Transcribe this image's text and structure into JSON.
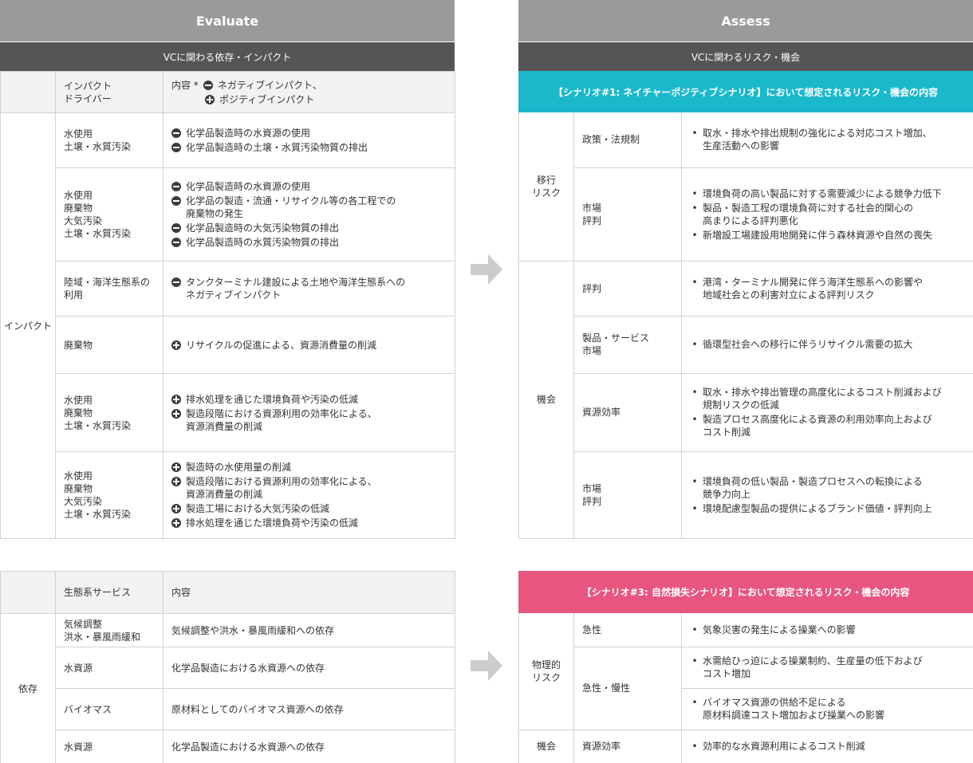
{
  "evaluate": {
    "title": "Evaluate",
    "subtitle": "VCに関わる依存・インパクト",
    "impact_table": {
      "header": {
        "driver": "インパクト\nドライバー",
        "content_label": "内容 *",
        "neg_label": "ネガティブインパクト、",
        "pos_label": "ポジティブインパクト"
      },
      "group_label": "インパクト",
      "rows": [
        {
          "driver": "水使用\n土壌・水質汚染",
          "items": [
            {
              "icon": "minus",
              "text": "化学品製造時の水資源の使用"
            },
            {
              "icon": "minus",
              "text": "化学品製造時の土壌・水質汚染物質の排出"
            }
          ]
        },
        {
          "driver": "水使用\n廃棄物\n大気汚染\n土壌・水質汚染",
          "items": [
            {
              "icon": "minus",
              "text": "化学品製造時の水資源の使用"
            },
            {
              "icon": "minus",
              "text": "化学品の製造・流通・リサイクル等の各工程での\n廃棄物の発生"
            },
            {
              "icon": "minus",
              "text": "化学品製造時の大気汚染物質の排出"
            },
            {
              "icon": "minus",
              "text": "化学品製造時の水質汚染物質の排出"
            }
          ]
        },
        {
          "driver": "陸域・海洋生態系の\n利用",
          "items": [
            {
              "icon": "minus",
              "text": "タンクターミナル建設による土地や海洋生態系への\nネガティブインパクト"
            }
          ]
        },
        {
          "driver": "廃棄物",
          "items": [
            {
              "icon": "plus",
              "text": "リサイクルの促進による、資源消費量の削減"
            }
          ]
        },
        {
          "driver": "水使用\n廃棄物\n土壌・水質汚染",
          "items": [
            {
              "icon": "plus",
              "text": "排水処理を通じた環境負荷や汚染の低減"
            },
            {
              "icon": "plus",
              "text": "製造段階における資源利用の効率化による、\n資源消費量の削減"
            }
          ]
        },
        {
          "driver": "水使用\n廃棄物\n大気汚染\n土壌・水質汚染",
          "items": [
            {
              "icon": "plus",
              "text": "製造時の水使用量の削減"
            },
            {
              "icon": "plus",
              "text": "製造段階における資源利用の効率化による、\n資源消費量の削減"
            },
            {
              "icon": "plus",
              "text": "製造工場における大気汚染の低減"
            },
            {
              "icon": "plus",
              "text": "排水処理を通じた環境負荷や汚染の低減"
            }
          ]
        }
      ]
    },
    "dependency_table": {
      "header": {
        "service": "生態系サービス",
        "content": "内容"
      },
      "group_label": "依存",
      "rows": [
        {
          "service": "気候調整\n洪水・暴風雨緩和",
          "content": "気候調整や洪水・暴風雨緩和への依存"
        },
        {
          "service": "水資源",
          "content": "化学品製造における水資源への依存"
        },
        {
          "service": "バイオマス",
          "content": "原材料としてのバイオマス資源への依存"
        },
        {
          "service": "水資源",
          "content": "化学品製造における水資源への依存"
        }
      ]
    }
  },
  "assess": {
    "title": "Assess",
    "subtitle": "VCに関わるリスク・機会",
    "scenario1": {
      "title": "【シナリオ#1: ネイチャーポジティブシナリオ】において想定されるリスク・機会の内容",
      "color": "#1bb8cc",
      "transition_label": "移行\nリスク",
      "opportunity_label": "機会",
      "rows": [
        {
          "category": "政策・法規制",
          "bullets": [
            "取水・排水や排出規制の強化による対応コスト増加、\n生産活動への影響"
          ]
        },
        {
          "category": "市場\n評判",
          "bullets": [
            "環境負荷の高い製品に対する需要減少による競争力低下",
            "製品・製造工程の環境負荷に対する社会的関心の\n高まりによる評判悪化",
            "新増設工場建設用地開発に伴う森林資源や自然の喪失"
          ]
        },
        {
          "category": "評判",
          "bullets": [
            "港湾・ターミナル開発に伴う海洋生態系への影響や\n地域社会との利害対立による評判リスク"
          ]
        },
        {
          "category": "製品・サービス\n市場",
          "bullets": [
            "循環型社会への移行に伴うリサイクル需要の拡大"
          ]
        },
        {
          "category": "資源効率",
          "bullets": [
            "取水・排水や排出管理の高度化によるコスト削減および\n規制リスクの低減",
            "製造プロセス高度化による資源の利用効率向上および\nコスト削減"
          ]
        },
        {
          "category": "市場\n評判",
          "bullets": [
            "環境負荷の低い製品・製造プロセスへの転換による\n競争力向上",
            "環境配慮型製品の提供によるブランド価値・評判向上"
          ]
        }
      ]
    },
    "scenario3": {
      "title": "【シナリオ#3: 自然損失シナリオ】において想定されるリスク・機会の内容",
      "color": "#e8557e",
      "physical_label": "物理的\nリスク",
      "opportunity_label": "機会",
      "rows": [
        {
          "category": "急性",
          "bullets": [
            "気象災害の発生による操業への影響"
          ]
        },
        {
          "category": "急性・慢性",
          "bullets": [
            "水需給ひっ迫による操業制約、生産量の低下および\nコスト増加"
          ]
        },
        {
          "category": "",
          "bullets": [
            "バイオマス資源の供給不足による\n原材料調達コスト増加および操業への影響"
          ]
        },
        {
          "category": "資源効率",
          "bullets": [
            "効率的な水資源利用によるコスト削減"
          ]
        }
      ]
    },
    "bullet_char": "•"
  },
  "arrow_icon": "right-arrow-icon"
}
